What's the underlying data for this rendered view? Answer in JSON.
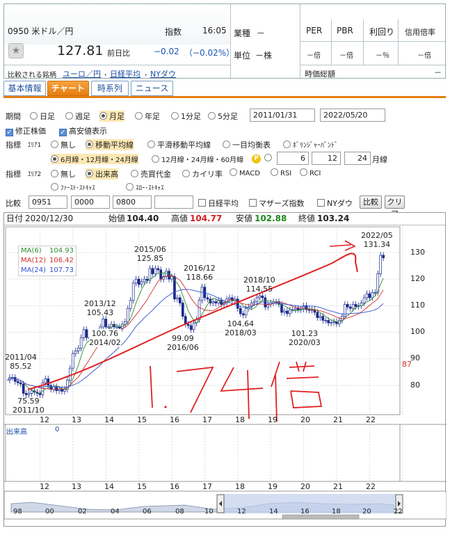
{
  "stock": {
    "code_name": "0950 米ドル／円",
    "index_label": "指数",
    "time": "16:05",
    "price": "127.81",
    "change_label": "前日比",
    "change": "−0.02",
    "change_pct": "（−0.02%）",
    "compare_label": "比較される銘柄",
    "compare_links": [
      "ユーロ／円",
      "日経平均",
      "NYダウ"
    ],
    "industry_label": "業種",
    "industry_value": "－",
    "unit_label": "単位",
    "unit_value": "－株",
    "metrics": [
      {
        "label": "PER",
        "value": "－倍"
      },
      {
        "label": "PBR",
        "value": "－倍"
      },
      {
        "label": "利回り",
        "value": "－％"
      },
      {
        "label": "信用倍率",
        "value": "－倍"
      }
    ],
    "market_cap_label": "時価総額",
    "market_cap_value": "－"
  },
  "tabs": [
    {
      "label": "基本情報",
      "active": false
    },
    {
      "label": "チャート",
      "active": true
    },
    {
      "label": "時系列",
      "active": false
    },
    {
      "label": "ニュース",
      "active": false
    }
  ],
  "period": {
    "label": "期間",
    "options": [
      "日足",
      "週足",
      "月足",
      "年足",
      "1分足",
      "5分足"
    ],
    "selected": "月足",
    "from": "2011/01/31",
    "to": "2022/05/20"
  },
  "toggles": {
    "adjusted": "修正株価",
    "high_low": "高安値表示"
  },
  "indicator1": {
    "label": "指標",
    "area": "ｴﾘｱ1",
    "options": [
      "無し",
      "移動平均線",
      "平滑移動平均線",
      "一目均衡表",
      "ﾎﾞﾘﾝｼﾞｬｰﾊﾞﾝﾄﾞ"
    ],
    "selected": "移動平均線",
    "ma_options": [
      "6月線・12月線・24月線",
      "12月線・24月線・60月線"
    ],
    "ma_selected": "6月線・12月線・24月線",
    "p_badge": "P",
    "custom": [
      "6",
      "12",
      "24"
    ],
    "custom_unit": "月線"
  },
  "indicator2": {
    "label": "指標",
    "area": "ｴﾘｱ2",
    "options": [
      "無し",
      "出来高",
      "売買代金",
      "カイリ率",
      "MACD",
      "RSI",
      "RCI",
      "ﾌｧｰｽﾄ･ｽﾄｷｬｽ",
      "ｽﾛｰ･ｽﾄｷｬｽ"
    ],
    "selected": "出来高"
  },
  "compare": {
    "label": "比較",
    "codes": [
      "0951",
      "0000",
      "0800",
      ""
    ],
    "checks": [
      "日経平均",
      "マザーズ指数",
      "NYダウ"
    ],
    "compare_button": "比較",
    "clear_button": "クリア"
  },
  "ohlc": {
    "date_label": "日付",
    "date": "2020/12/30",
    "open_label": "始値",
    "open": "104.40",
    "high_label": "高値",
    "high": "104.77",
    "low_label": "安値",
    "low": "102.88",
    "close_label": "終値",
    "close": "103.24"
  },
  "ma_legend": [
    {
      "name": "MA(6)",
      "value": "104.93",
      "color": "#2e8b2e"
    },
    {
      "name": "MA(12)",
      "value": "106.42",
      "color": "#d03030"
    },
    {
      "name": "MA(24)",
      "value": "107.73",
      "color": "#3050d0"
    }
  ],
  "annotations": [
    {
      "date": "2011/04",
      "value": "85.52"
    },
    {
      "date": "2011/10",
      "value": "75.59"
    },
    {
      "date": "2013/12",
      "value": "105.43"
    },
    {
      "date": "2014/02",
      "value": "100.76"
    },
    {
      "date": "2015/06",
      "value": "125.85"
    },
    {
      "date": "2016/06",
      "value": "99.09"
    },
    {
      "date": "2016/12",
      "value": "118.66"
    },
    {
      "date": "2018/10",
      "value": "114.55"
    },
    {
      "date": "2018/03",
      "value": "104.64"
    },
    {
      "date": "2020/03",
      "value": "101.23"
    },
    {
      "date": "2022/05",
      "value": "131.34"
    }
  ],
  "handwritten_note": "1.74倍",
  "volume_label": "出来高",
  "volume_value": "0",
  "price_ticks": [
    "130",
    "120",
    "110",
    "100",
    "90",
    "80"
  ],
  "current_price_tick": "87",
  "year_ticks": [
    "12",
    "13",
    "14",
    "15",
    "16",
    "17",
    "18",
    "19",
    "20",
    "21",
    "22"
  ],
  "nav_ticks": [
    "98",
    "00",
    "02",
    "04",
    "06",
    "08",
    "10",
    "12",
    "14",
    "16",
    "18",
    "20",
    "22"
  ],
  "colors": {
    "accent": "#e57e10",
    "up_candle": "#ffffff",
    "down_candle": "#1a2a8c",
    "annotation_red": "#e02020",
    "negative": "#1b55b5"
  }
}
